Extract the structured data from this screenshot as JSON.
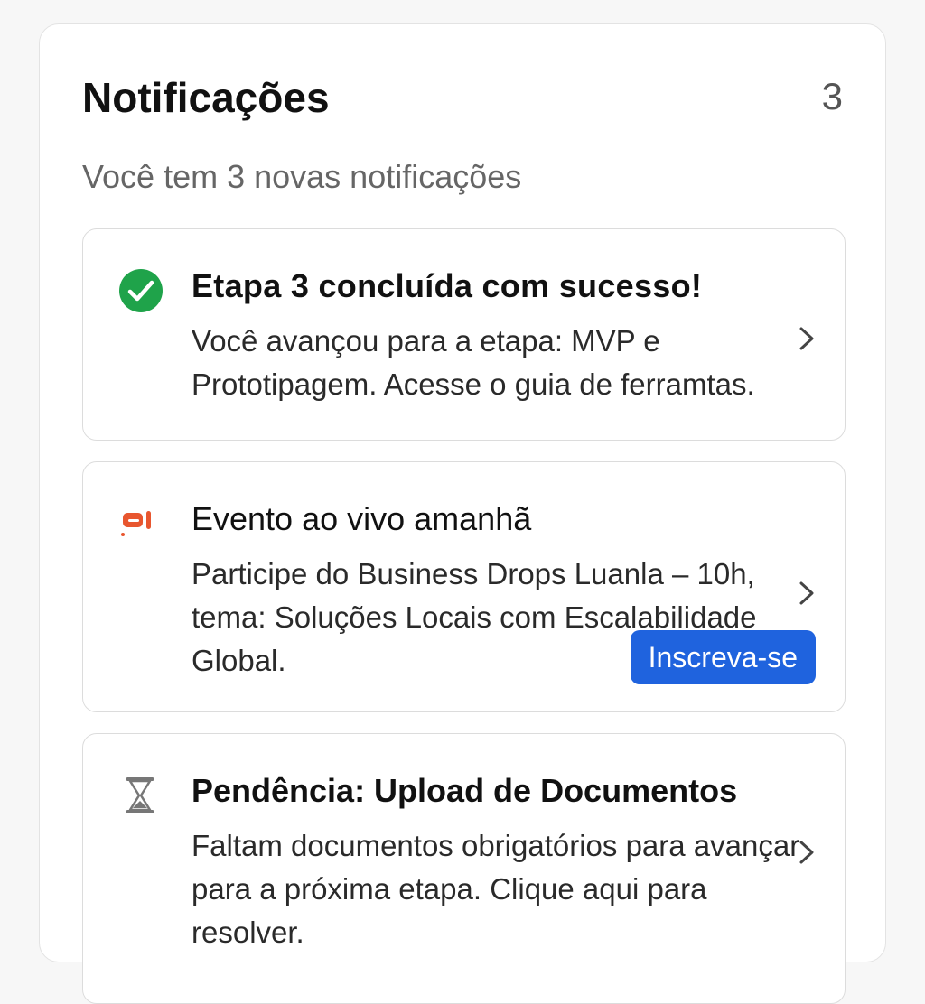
{
  "header": {
    "title": "Notificações",
    "count": "3",
    "subtitle": "Você tem 3 novas notificações"
  },
  "notifications": [
    {
      "icon": "check-circle-icon",
      "title": "Etapa 3 concluída com sucesso!",
      "body": "Você avançou para a etapa: MVP e Prototipagem. Acesse o guia de ferramtas."
    },
    {
      "icon": "megaphone-icon",
      "title": "Evento ao vivo amanhã",
      "body": "Participe do Business Drops Luanla – 10h, tema: Soluções Locais com Escalabilidade Global.",
      "action_label": "Inscreva-se"
    },
    {
      "icon": "hourglass-icon",
      "title": "Pendência: Upload de Documentos",
      "body": "Faltam documentos obrigatórios para avançar para a próxima etapa. Clique aqui para resolver."
    }
  ],
  "colors": {
    "success": "#1fa34a",
    "event": "#e8562f",
    "primary_button": "#1f63de",
    "pending_icon": "#777777"
  }
}
